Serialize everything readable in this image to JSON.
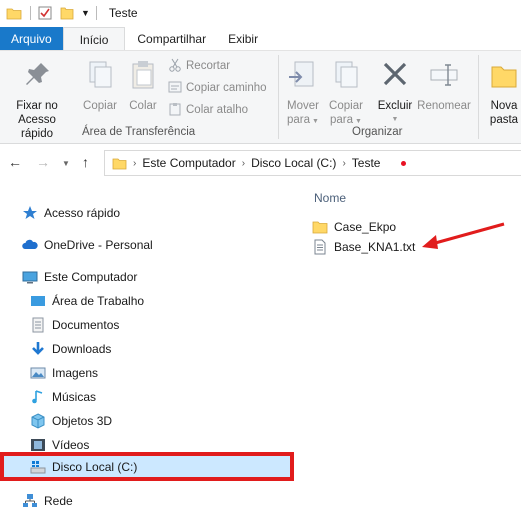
{
  "window": {
    "title": "Teste"
  },
  "ribbon_tabs": {
    "file": "Arquivo",
    "home": "Início",
    "share": "Compartilhar",
    "view": "Exibir"
  },
  "ribbon": {
    "pin_line1": "Fixar no",
    "pin_line2": "Acesso rápido",
    "copy": "Copiar",
    "paste": "Colar",
    "cut": "Recortar",
    "copy_path": "Copiar caminho",
    "paste_shortcut": "Colar atalho",
    "clipboard_group": "Área de Transferência",
    "move_line1": "Mover",
    "move_line2": "para",
    "copy_to_line1": "Copiar",
    "copy_to_line2": "para",
    "delete": "Excluir",
    "rename": "Renomear",
    "organize_group": "Organizar",
    "new_line1": "Nova",
    "new_line2": "pasta"
  },
  "address": {
    "crumbs": [
      "Este Computador",
      "Disco Local (C:)",
      "Teste"
    ]
  },
  "nav": {
    "quick_access": "Acesso rápido",
    "onedrive": "OneDrive - Personal",
    "this_pc": "Este Computador",
    "desktop": "Área de Trabalho",
    "documents": "Documentos",
    "downloads": "Downloads",
    "pictures": "Imagens",
    "music": "Músicas",
    "objects3d": "Objetos 3D",
    "videos": "Vídeos",
    "local_disk": "Disco Local (C:)",
    "network": "Rede"
  },
  "content": {
    "column_name": "Nome",
    "items": [
      {
        "name": "Case_Ekpo",
        "type": "folder"
      },
      {
        "name": "Base_KNA1.txt",
        "type": "text-file"
      }
    ]
  },
  "colors": {
    "file_tab": "#1979ca",
    "selection": "#cce8ff",
    "annotation_red": "#e11c1c",
    "folder_yellow": "#ffd867"
  }
}
